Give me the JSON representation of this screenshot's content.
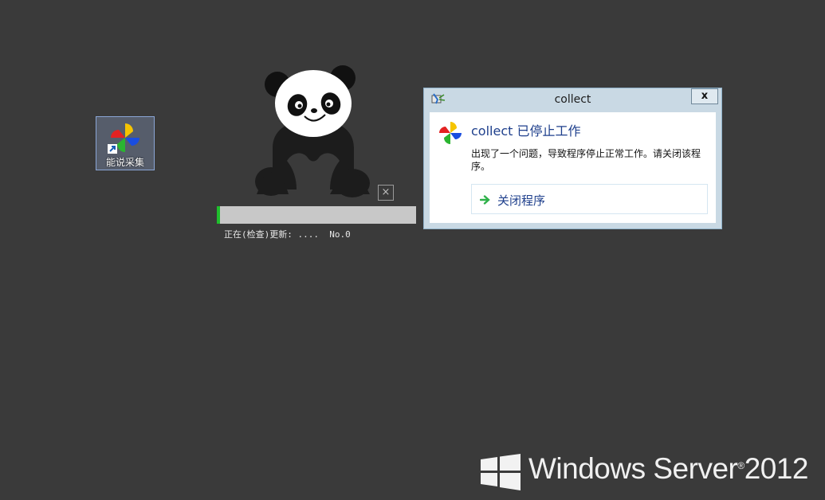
{
  "desktop": {
    "background": "#3a3a3a",
    "shortcut": {
      "label": "能说采集",
      "icon": "pinwheel-app-icon"
    }
  },
  "splash": {
    "close_symbol": "×",
    "progress": {
      "fraction": 0.015,
      "color": "#1fbf2c"
    },
    "status_text": "正在(检查)更新: ....  No.0"
  },
  "error_dialog": {
    "title": "collect",
    "close_symbol": "x",
    "heading": "collect 已停止工作",
    "message": "出现了一个问题，导致程序停止正常工作。请关闭该程序。",
    "close_program_label": "关闭程序",
    "accent_color": "#1e3f8c"
  },
  "branding": {
    "text": "Windows Server",
    "version": "2012"
  }
}
